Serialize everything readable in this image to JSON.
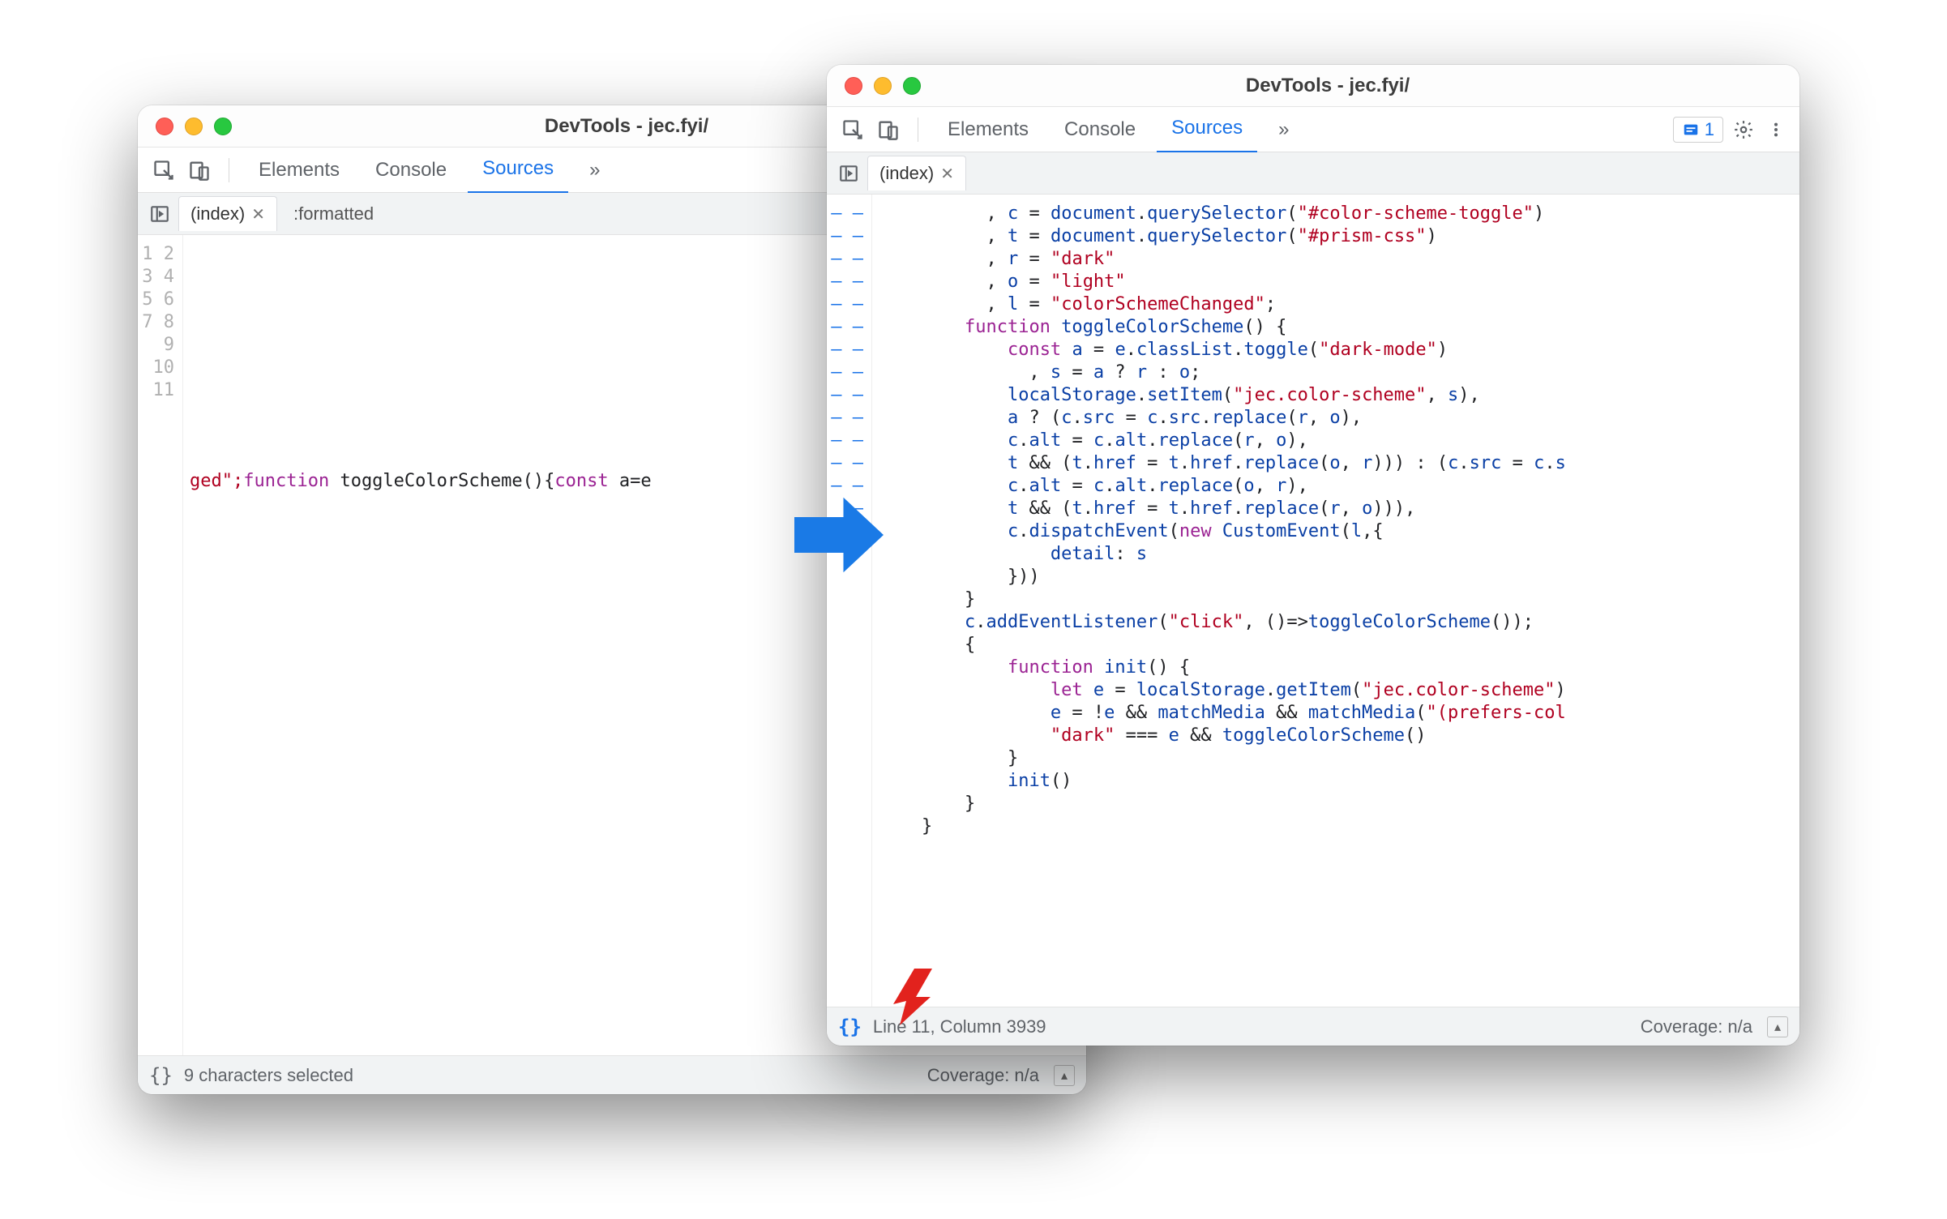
{
  "left": {
    "title": "DevTools - jec.fyi/",
    "tabs": {
      "elements": "Elements",
      "console": "Console",
      "sources": "Sources",
      "more": "»"
    },
    "filetabs": {
      "index": "(index)",
      "formatted": ":formatted"
    },
    "gutter": [
      "1",
      "2",
      "3",
      "4",
      "5",
      "6",
      "7",
      "8",
      "9",
      "10",
      "11"
    ],
    "codeLine11": {
      "pre": "ged\";",
      "fn": "function",
      "name": " toggleColorScheme(){",
      "const": "const",
      "tail": " a=e"
    },
    "status": {
      "msg": "9 characters selected",
      "coverage": "Coverage: n/a"
    }
  },
  "right": {
    "title": "DevTools - jec.fyi/",
    "tabs": {
      "elements": "Elements",
      "console": "Console",
      "sources": "Sources",
      "more": "»"
    },
    "issuesCount": "1",
    "filetabs": {
      "index": "(index)"
    },
    "status": {
      "cursor": "Line 11, Column 3939",
      "coverage": "Coverage: n/a"
    }
  },
  "icons": {
    "inspect": "inspect-icon",
    "device": "device-icon",
    "gear": "gear-icon",
    "kebab": "kebab-icon",
    "pretty": "{}"
  }
}
